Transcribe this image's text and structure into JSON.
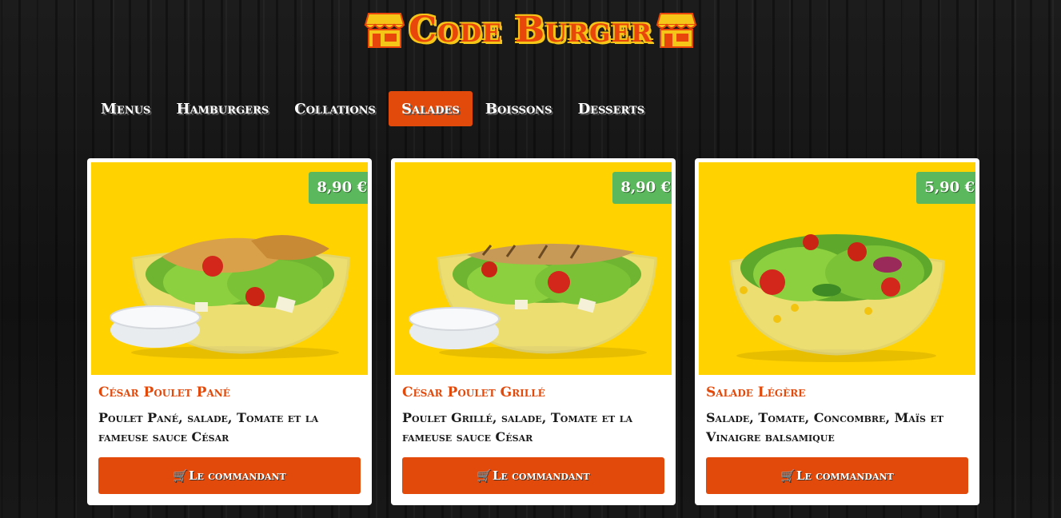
{
  "brand": {
    "title": "Code Burger",
    "icon": "shop-icon"
  },
  "nav": {
    "items": [
      {
        "label": "Menus",
        "active": false
      },
      {
        "label": "Hamburgers",
        "active": false
      },
      {
        "label": "Collations",
        "active": false
      },
      {
        "label": "Salades",
        "active": true
      },
      {
        "label": "Boissons",
        "active": false
      },
      {
        "label": "Desserts",
        "active": false
      }
    ]
  },
  "colors": {
    "accent": "#e24a0c",
    "price": "#5cb85c",
    "card_bg": "#ffd200",
    "brand_outline": "#f5c518"
  },
  "cards": [
    {
      "price": "8,90 €",
      "title": "César Poulet Pané",
      "desc": "Poulet Pané, salade, Tomate et la fameuse sauce César",
      "button": "Le commandant",
      "button_icon": "cart-icon"
    },
    {
      "price": "8,90 €",
      "title": "César Poulet Grillé",
      "desc": "Poulet Grillé, salade, Tomate et la fameuse sauce César",
      "button": "Le commandant",
      "button_icon": "cart-icon"
    },
    {
      "price": "5,90 €",
      "title": "Salade Légère",
      "desc": "Salade, Tomate, Concombre, Maïs et Vinaigre balsamique",
      "button": "Le commandant",
      "button_icon": "cart-icon"
    }
  ]
}
